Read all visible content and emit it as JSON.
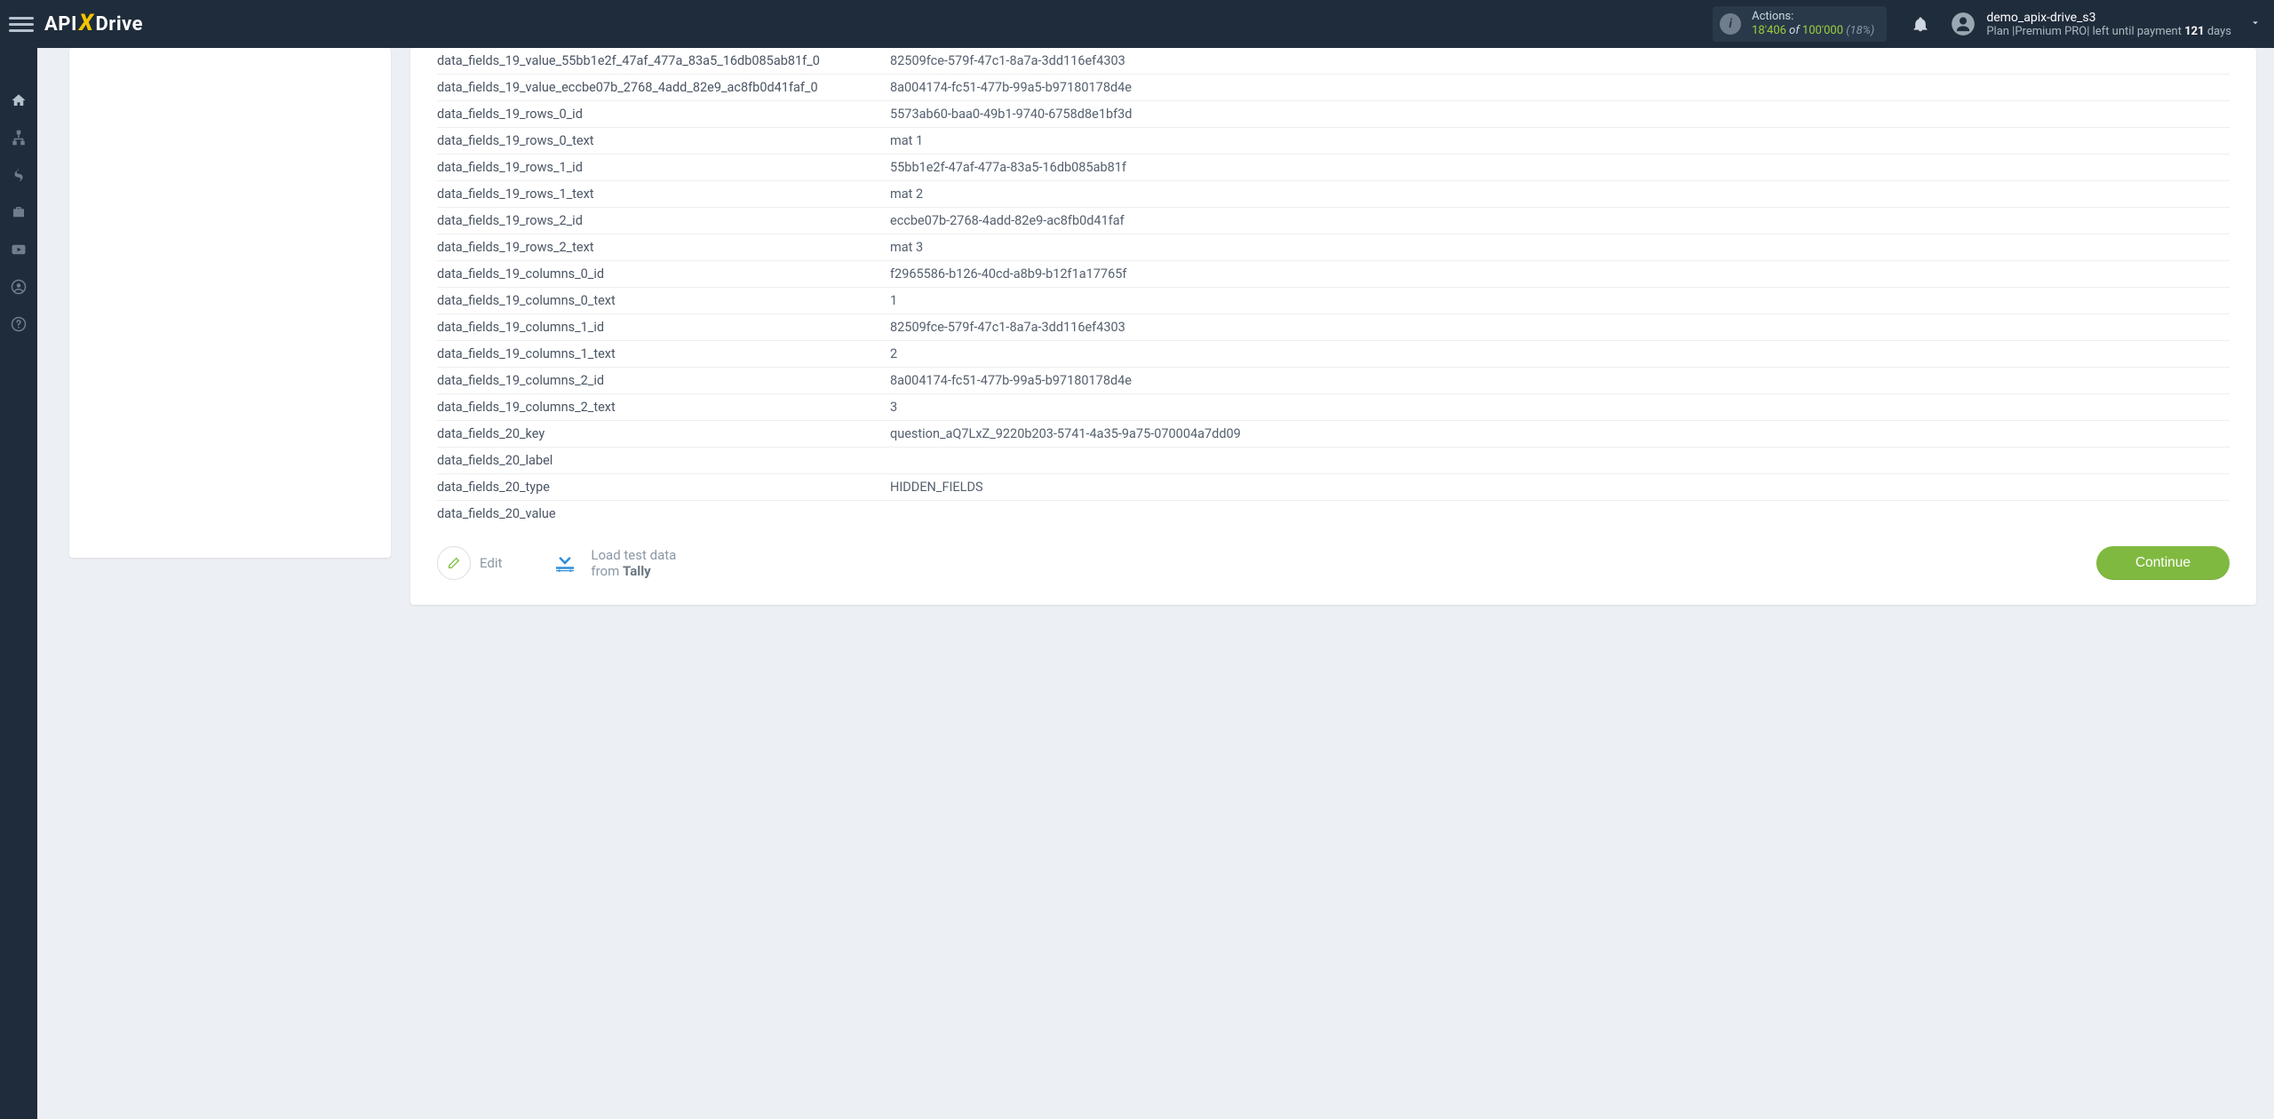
{
  "header": {
    "logo": {
      "a": "API",
      "x": "X",
      "b": "Drive"
    },
    "actions": {
      "label": "Actions:",
      "current": "18'406",
      "of": " of ",
      "max": "100'000",
      "pct": " (18%)"
    },
    "user": {
      "name": "demo_apix-drive_s3",
      "plan_prefix": "Plan |Premium PRO| left until payment ",
      "days_num": "121",
      "days_suffix": " days"
    }
  },
  "table_rows": [
    {
      "k": "data_fields_19_value_55bb1e2f_47af_477a_83a5_16db085ab81f_0",
      "v": "82509fce-579f-47c1-8a7a-3dd116ef4303"
    },
    {
      "k": "data_fields_19_value_eccbe07b_2768_4add_82e9_ac8fb0d41faf_0",
      "v": "8a004174-fc51-477b-99a5-b97180178d4e"
    },
    {
      "k": "data_fields_19_rows_0_id",
      "v": "5573ab60-baa0-49b1-9740-6758d8e1bf3d"
    },
    {
      "k": "data_fields_19_rows_0_text",
      "v": "mat 1"
    },
    {
      "k": "data_fields_19_rows_1_id",
      "v": "55bb1e2f-47af-477a-83a5-16db085ab81f"
    },
    {
      "k": "data_fields_19_rows_1_text",
      "v": "mat 2"
    },
    {
      "k": "data_fields_19_rows_2_id",
      "v": "eccbe07b-2768-4add-82e9-ac8fb0d41faf"
    },
    {
      "k": "data_fields_19_rows_2_text",
      "v": "mat 3"
    },
    {
      "k": "data_fields_19_columns_0_id",
      "v": "f2965586-b126-40cd-a8b9-b12f1a17765f"
    },
    {
      "k": "data_fields_19_columns_0_text",
      "v": "1"
    },
    {
      "k": "data_fields_19_columns_1_id",
      "v": "82509fce-579f-47c1-8a7a-3dd116ef4303"
    },
    {
      "k": "data_fields_19_columns_1_text",
      "v": "2"
    },
    {
      "k": "data_fields_19_columns_2_id",
      "v": "8a004174-fc51-477b-99a5-b97180178d4e"
    },
    {
      "k": "data_fields_19_columns_2_text",
      "v": "3"
    },
    {
      "k": "data_fields_20_key",
      "v": "question_aQ7LxZ_9220b203-5741-4a35-9a75-070004a7dd09"
    },
    {
      "k": "data_fields_20_label",
      "v": ""
    },
    {
      "k": "data_fields_20_type",
      "v": "HIDDEN_FIELDS"
    },
    {
      "k": "data_fields_20_value",
      "v": ""
    }
  ],
  "buttons": {
    "edit": "Edit",
    "load_line1": "Load test data",
    "load_line2_prefix": "from ",
    "load_line2_source": "Tally",
    "continue": "Continue"
  }
}
